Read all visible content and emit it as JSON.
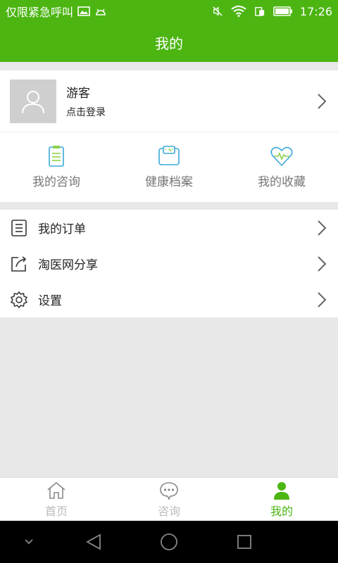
{
  "status_bar": {
    "carrier": "仅限紧急呼叫",
    "time": "17:26"
  },
  "header": {
    "title": "我的"
  },
  "profile": {
    "name": "游客",
    "subtitle": "点击登录"
  },
  "quick_actions": [
    {
      "label": "我的咨询",
      "icon": "clipboard-icon"
    },
    {
      "label": "健康档案",
      "icon": "scale-icon"
    },
    {
      "label": "我的收藏",
      "icon": "heart-icon"
    }
  ],
  "menu": [
    {
      "label": "我的订单",
      "icon": "order-list-icon"
    },
    {
      "label": "淘医网分享",
      "icon": "share-icon"
    },
    {
      "label": "设置",
      "icon": "gear-icon"
    }
  ],
  "tabs": [
    {
      "label": "首页",
      "icon": "home-icon",
      "active": false
    },
    {
      "label": "咨询",
      "icon": "chat-bubble-icon",
      "active": false
    },
    {
      "label": "我的",
      "icon": "person-icon",
      "active": true
    }
  ],
  "colors": {
    "brand_green": "#4cb512",
    "quick_icon_blue": "#3aa8d8",
    "quick_icon_green": "#8ad04a"
  }
}
